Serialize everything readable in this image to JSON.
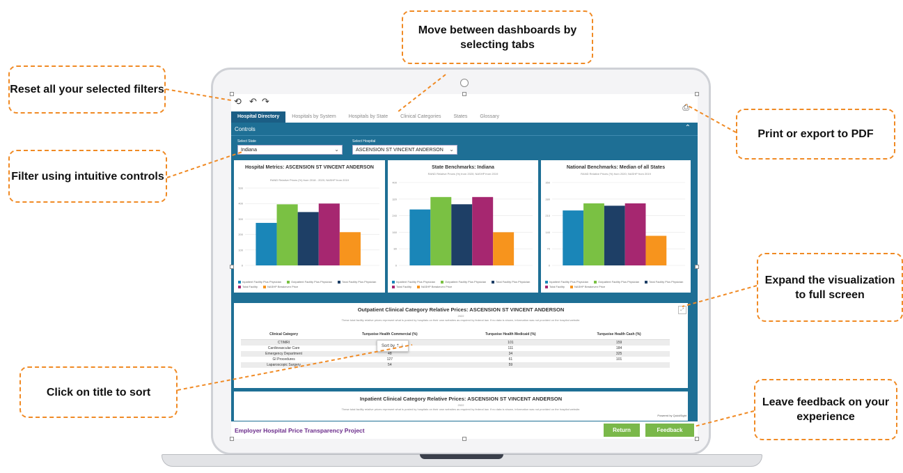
{
  "callouts": {
    "tabs": "Move between dashboards by selecting tabs",
    "reset": "Reset all your selected filters",
    "print": "Print or export to PDF",
    "filter": "Filter using intuitive controls",
    "expand": "Expand the visualization to full screen",
    "sort": "Click on title to sort",
    "feedback": "Leave feedback on your experience"
  },
  "colors": {
    "accent_callout": "#f08a24",
    "dashboard_bg": "#1e6f95",
    "button_green": "#7ab84a",
    "series": [
      "#1a86b8",
      "#7ac143",
      "#1e3f66",
      "#a62770",
      "#f7941d"
    ]
  },
  "toolbar": {
    "reset_icon": "reset-icon",
    "undo_icon": "undo-icon",
    "redo_icon": "redo-icon",
    "print_icon": "print-icon"
  },
  "tabs": [
    {
      "label": "Hospital Directory",
      "active": true
    },
    {
      "label": "Hospitals by System",
      "active": false
    },
    {
      "label": "Hospitals by State",
      "active": false
    },
    {
      "label": "Clinical Categories",
      "active": false
    },
    {
      "label": "States",
      "active": false
    },
    {
      "label": "Glossary",
      "active": false
    }
  ],
  "controls": {
    "label": "Controls",
    "state_label": "Select State",
    "state_value": "Indiana",
    "hospital_label": "Select Hospital",
    "hospital_value": "ASCENSION ST VINCENT ANDERSON"
  },
  "charts": [
    {
      "title": "Hospital Metrics: ASCENSION ST VINCENT ANDERSON",
      "subtitle": "RAND Relative Prices (%) from 2018 - 2020; NASHP from 2019"
    },
    {
      "title": "State Benchmarks: Indiana",
      "subtitle": "RAND Relative Prices (%) from 2020; NASHP from 2019"
    },
    {
      "title": "National Benchmarks: Median of all States",
      "subtitle": "RAND Relative Prices (%) from 2020; NASHP from 2019"
    }
  ],
  "legend": [
    "Inpatient Facility Plus Physician",
    "Outpatient Facility Plus Physician",
    "Total Facility Plus Physician",
    "Total Facility",
    "NASHP Breakeven Price"
  ],
  "chart_data": [
    {
      "type": "bar",
      "categories": [
        "Hospital"
      ],
      "series": [
        {
          "name": "Inpatient Facility Plus Physician",
          "values": [
            275
          ]
        },
        {
          "name": "Outpatient Facility Plus Physician",
          "values": [
            395
          ]
        },
        {
          "name": "Total Facility Plus Physician",
          "values": [
            345
          ]
        },
        {
          "name": "Total Facility",
          "values": [
            400
          ]
        },
        {
          "name": "NASHP Breakeven Price",
          "values": [
            215
          ]
        }
      ],
      "ylim": [
        0,
        500
      ]
    },
    {
      "type": "bar",
      "categories": [
        "State"
      ],
      "series": [
        {
          "name": "Inpatient Facility Plus Physician",
          "values": [
            270
          ]
        },
        {
          "name": "Outpatient Facility Plus Physician",
          "values": [
            330
          ]
        },
        {
          "name": "Total Facility Plus Physician",
          "values": [
            295
          ]
        },
        {
          "name": "Total Facility",
          "values": [
            330
          ]
        },
        {
          "name": "NASHP Breakeven Price",
          "values": [
            160
          ]
        }
      ],
      "ylim": [
        0,
        400
      ]
    },
    {
      "type": "bar",
      "categories": [
        "National"
      ],
      "series": [
        {
          "name": "Inpatient Facility Plus Physician",
          "values": [
            232
          ]
        },
        {
          "name": "Outpatient Facility Plus Physician",
          "values": [
            262
          ]
        },
        {
          "name": "Total Facility Plus Physician",
          "values": [
            252
          ]
        },
        {
          "name": "Total Facility",
          "values": [
            262
          ]
        },
        {
          "name": "NASHP Breakeven Price",
          "values": [
            125
          ]
        }
      ],
      "ylim": [
        0,
        350
      ]
    }
  ],
  "outpatient": {
    "title": "Outpatient Clinical Category Relative Prices: ASCENSION ST VINCENT ANDERSON",
    "year": "2022",
    "note": "These total facility relative prices represent what is posted by hospitals on their own websites as required by federal law. If no data is shown, information was not provided on the hospital website.",
    "headers": [
      "Clinical Category",
      "Turquoise Health Commercial (%)",
      "Turquoise Health Medicaid (%)",
      "Turquoise Health Cash (%)"
    ],
    "rows": [
      [
        "CT/MRI",
        "",
        "101",
        "159"
      ],
      [
        "Cardiovascular Care",
        "69",
        "111",
        "184"
      ],
      [
        "Emergency Department",
        "48",
        "34",
        "325"
      ],
      [
        "GI Procedures",
        "127",
        "61",
        "101"
      ],
      [
        "Laparoscopic Surgery",
        "54",
        "59",
        ""
      ]
    ],
    "sort_label": "Sort by"
  },
  "inpatient": {
    "title": "Inpatient Clinical Category Relative Prices: ASCENSION ST VINCENT ANDERSON",
    "year": "2022",
    "note": "These total facility relative prices represent what is posted by hospitals on their own websites as required by federal law. If no data is shown, information was not provided on the hospital website."
  },
  "footer": {
    "project_title": "Employer Hospital Price Transparency Project",
    "powered_by": "Powered by QuickSight",
    "return_label": "Return",
    "feedback_label": "Feedback"
  }
}
